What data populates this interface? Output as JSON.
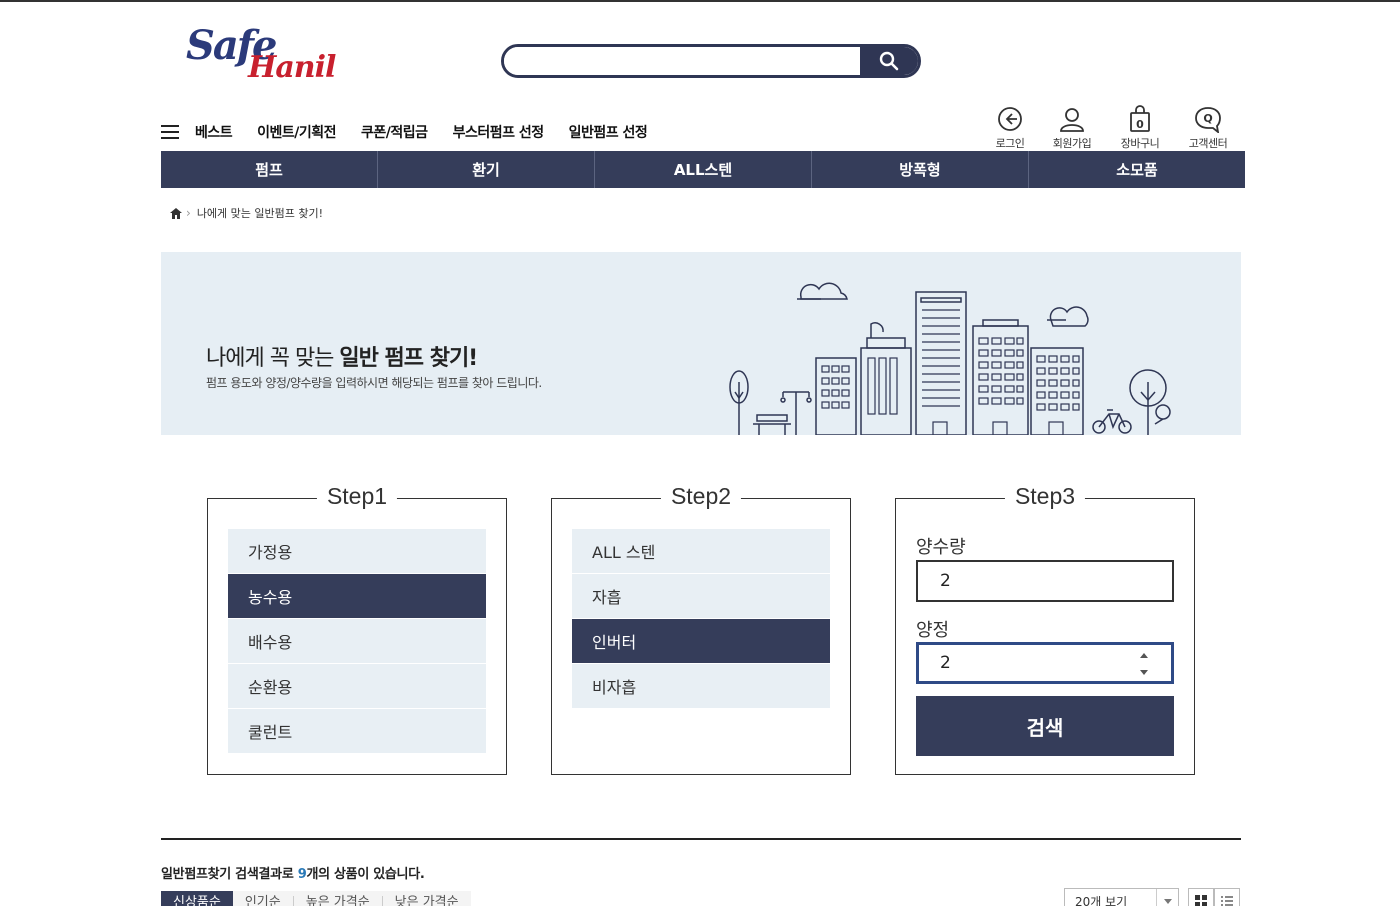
{
  "brand": {
    "logo_word1": "Safe",
    "logo_word2": "Hanil",
    "primary_color": "#353d5a",
    "accent_red": "#c8202e"
  },
  "search": {
    "value": "",
    "placeholder": ""
  },
  "gnb": {
    "items": [
      "베스트",
      "이벤트/기획전",
      "쿠폰/적립금",
      "부스터펌프 선정",
      "일반펌프 선정"
    ]
  },
  "util": {
    "login": "로그인",
    "join": "회원가입",
    "cart": "장바구니",
    "cart_count": "0",
    "support": "고객센터",
    "support_glyph": "Q"
  },
  "categories": [
    "펌프",
    "환기",
    "ALL스텐",
    "방폭형",
    "소모품"
  ],
  "breadcrumb": {
    "current": "나에게 맞는 일반펌프 찾기!"
  },
  "banner": {
    "title_normal": "나에게 꼭 맞는 ",
    "title_bold": "일반 펌프 찾기!",
    "subtitle": "펌프 용도와 양정/양수량을 입력하시면 해당되는 펌프를 찾아 드립니다."
  },
  "step1": {
    "title": "Step1",
    "options": [
      "가정용",
      "농수용",
      "배수용",
      "순환용",
      "쿨런트"
    ],
    "selected": "농수용"
  },
  "step2": {
    "title": "Step2",
    "options": [
      "ALL 스텐",
      "자흡",
      "인버터",
      "비자흡"
    ],
    "selected": "인버터"
  },
  "step3": {
    "title": "Step3",
    "flow_label": "양수량",
    "flow_value": "2",
    "head_label": "양정",
    "head_value": "2",
    "submit": "검색"
  },
  "results": {
    "prefix": "일반펌프찾기 검색결과로 ",
    "count": "9",
    "suffix": "개의 상품이 있습니다.",
    "sort_tabs": [
      "신상품순",
      "인기순",
      "높은 가격순",
      "낮은 가격순"
    ],
    "active_sort": "신상품순",
    "per_page": "20개 보기"
  }
}
